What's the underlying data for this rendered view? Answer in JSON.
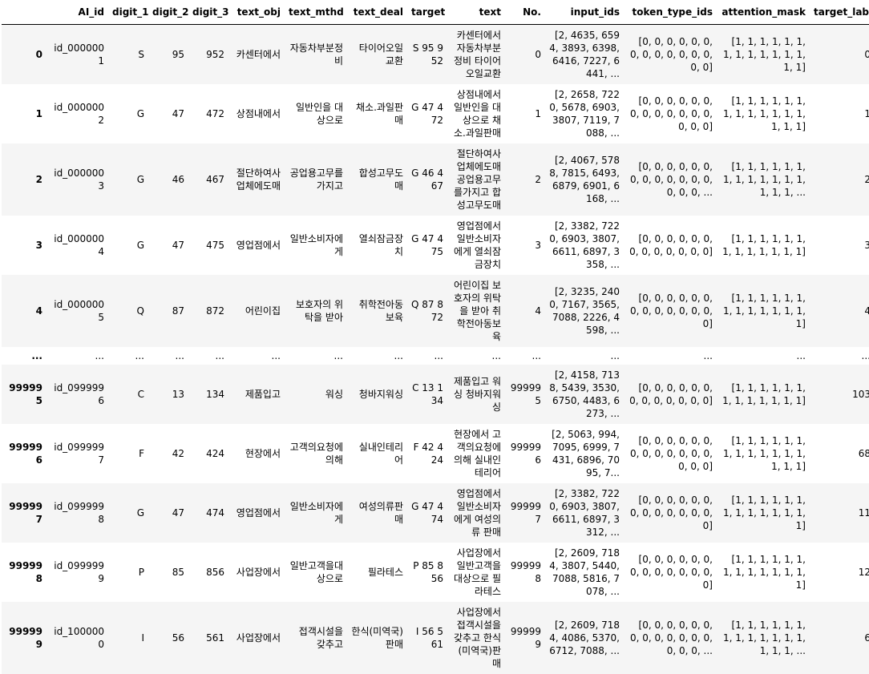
{
  "columns": [
    "",
    "AI_id",
    "digit_1",
    "digit_2",
    "digit_3",
    "text_obj",
    "text_mthd",
    "text_deal",
    "target",
    "text",
    "No.",
    "input_ids",
    "token_type_ids",
    "attention_mask",
    "target_label"
  ],
  "rows": [
    [
      "0",
      "id_0000001",
      "S",
      "95",
      "952",
      "카센터에서",
      "자동차부분정비",
      "타이어오일교환",
      "S 95 952",
      "카센터에서 자동차부분정비 타이어오일교환",
      "0",
      "[2, 4635, 6594, 3893, 6398, 6416, 7227, 6441, ...",
      "[0, 0, 0, 0, 0, 0, 0, 0, 0, 0, 0, 0, 0, 0, 0]",
      "[1, 1, 1, 1, 1, 1, 1, 1, 1, 1, 1, 1, 1, 1, 1]",
      "0"
    ],
    [
      "1",
      "id_0000002",
      "G",
      "47",
      "472",
      "상점내에서",
      "일반인을 대상으로",
      "채소.과일판매",
      "G 47 472",
      "상점내에서 일반인을 대상으로 채소.과일판매",
      "1",
      "[2, 2658, 7220, 5678, 6903, 3807, 7119, 7088, ...",
      "[0, 0, 0, 0, 0, 0, 0, 0, 0, 0, 0, 0, 0, 0, 0, 0]",
      "[1, 1, 1, 1, 1, 1, 1, 1, 1, 1, 1, 1, 1, 1, 1, 1]",
      "1"
    ],
    [
      "2",
      "id_0000003",
      "G",
      "46",
      "467",
      "절단하여사업체에도매",
      "공업용고무를가지고",
      "합성고무도매",
      "G 46 467",
      "절단하여사업체에도매 공업용고무를가지고 합성고무도매",
      "2",
      "[2, 4067, 5788, 7815, 6493, 6879, 6901, 6168, ...",
      "[0, 0, 0, 0, 0, 0, 0, 0, 0, 0, 0, 0, 0, 0, 0, 0, ...",
      "[1, 1, 1, 1, 1, 1, 1, 1, 1, 1, 1, 1, 1, 1, 1, 1, ...",
      "2"
    ],
    [
      "3",
      "id_0000004",
      "G",
      "47",
      "475",
      "영업점에서",
      "일반소비자에게",
      "열쇠잠금장치",
      "G 47 475",
      "영업점에서 일반소비자에게 열쇠잠금장치",
      "3",
      "[2, 3382, 7220, 6903, 3807, 6611, 6897, 3358, ...",
      "[0, 0, 0, 0, 0, 0, 0, 0, 0, 0, 0, 0, 0]",
      "[1, 1, 1, 1, 1, 1, 1, 1, 1, 1, 1, 1, 1]",
      "3"
    ],
    [
      "4",
      "id_0000005",
      "Q",
      "87",
      "872",
      "어린이집",
      "보호자의 위탁을 받아",
      "취학전아동보육",
      "Q 87 872",
      "어린이집 보호자의 위탁을 받아 취학전아동보육",
      "4",
      "[2, 3235, 2400, 7167, 3565, 7088, 2226, 4598, ...",
      "[0, 0, 0, 0, 0, 0, 0, 0, 0, 0, 0, 0, 0, 0]",
      "[1, 1, 1, 1, 1, 1, 1, 1, 1, 1, 1, 1, 1, 1]",
      "4"
    ],
    [
      "...",
      "...",
      "...",
      "...",
      "...",
      "...",
      "...",
      "...",
      "...",
      "...",
      "...",
      "...",
      "...",
      "...",
      "..."
    ],
    [
      "999995",
      "id_0999996",
      "C",
      "13",
      "134",
      "제품입고",
      "워싱",
      "청바지워싱",
      "C 13 134",
      "제품입고 워싱 청바지워싱",
      "999995",
      "[2, 4158, 7138, 5439, 3530, 6750, 4483, 6273, ...",
      "[0, 0, 0, 0, 0, 0, 0, 0, 0, 0, 0, 0, 0]",
      "[1, 1, 1, 1, 1, 1, 1, 1, 1, 1, 1, 1, 1]",
      "103"
    ],
    [
      "999996",
      "id_0999997",
      "F",
      "42",
      "424",
      "현장에서",
      "고객의요청에의해",
      "실내인테리어",
      "F 42 424",
      "현장에서 고객의요청에의해 실내인테리어",
      "999996",
      "[2, 5063, 994, 7095, 6999, 7431, 6896, 7095, 7...",
      "[0, 0, 0, 0, 0, 0, 0, 0, 0, 0, 0, 0, 0, 0, 0, 0]",
      "[1, 1, 1, 1, 1, 1, 1, 1, 1, 1, 1, 1, 1, 1, 1, 1]",
      "68"
    ],
    [
      "999997",
      "id_0999998",
      "G",
      "47",
      "474",
      "영업점에서",
      "일반소비자에게",
      "여성의류판매",
      "G 47 474",
      "영업점에서 일반소비자에게 여성의류 판매",
      "999997",
      "[2, 3382, 7220, 6903, 3807, 6611, 6897, 3312, ...",
      "[0, 0, 0, 0, 0, 0, 0, 0, 0, 0, 0, 0, 0, 0]",
      "[1, 1, 1, 1, 1, 1, 1, 1, 1, 1, 1, 1, 1, 1]",
      "11"
    ],
    [
      "999998",
      "id_0999999",
      "P",
      "85",
      "856",
      "사업장에서",
      "일반고객을대상으로",
      "필라테스",
      "P 85 856",
      "사업장에서 일반고객을대상으로 필라테스",
      "999998",
      "[2, 2609, 7184, 3807, 5440, 7088, 5816, 7078, ...",
      "[0, 0, 0, 0, 0, 0, 0, 0, 0, 0, 0, 0, 0, 0]",
      "[1, 1, 1, 1, 1, 1, 1, 1, 1, 1, 1, 1, 1, 1]",
      "12"
    ],
    [
      "999999",
      "id_1000000",
      "I",
      "56",
      "561",
      "사업장에서",
      "접객시설을 갖추고",
      "한식(미역국)판매",
      "I 56 561",
      "사업장에서 접객시설을 갖추고 한식(미역국)판매",
      "999999",
      "[2, 2609, 7184, 4086, 5370, 6712, 7088, ...",
      "[0, 0, 0, 0, 0, 0, 0, 0, 0, 0, 0, 0, 0, 0, 0, 0, ...",
      "[1, 1, 1, 1, 1, 1, 1, 1, 1, 1, 1, 1, 1, 1, 1, 1, ...",
      "6"
    ]
  ]
}
